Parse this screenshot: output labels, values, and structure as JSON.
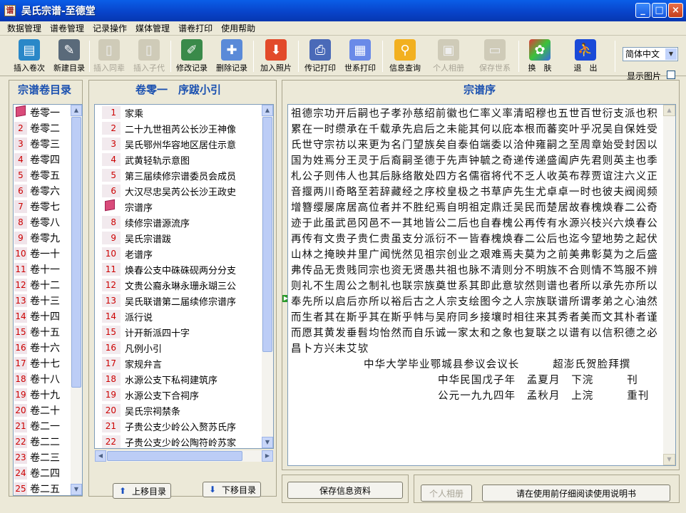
{
  "window": {
    "title": "吴氏宗谱-至德堂",
    "icon_glyph": "谱",
    "minimize": "_",
    "maximize": "□",
    "close": "×"
  },
  "menu": [
    "数据管理",
    "谱卷管理",
    "记录操作",
    "媒体管理",
    "谱卷打印",
    "使用帮助"
  ],
  "toolbar": [
    {
      "label": "插入卷次",
      "icon": "notebook-icon",
      "enabled": true
    },
    {
      "label": "新建目录",
      "icon": "pen-icon",
      "enabled": true
    },
    {
      "label": "插入同辈",
      "icon": "document-icon",
      "enabled": false
    },
    {
      "label": "插入子代",
      "icon": "document-icon",
      "enabled": false
    },
    {
      "label": "修改记录",
      "icon": "edit-icon",
      "enabled": true
    },
    {
      "label": "删除记录",
      "icon": "puzzle-icon",
      "enabled": true
    },
    {
      "label": "加入照片",
      "icon": "download-arrow-icon",
      "enabled": true
    },
    {
      "label": "传记打印",
      "icon": "printer-icon",
      "enabled": true
    },
    {
      "label": "世系打印",
      "icon": "paper-roll-icon",
      "enabled": true
    },
    {
      "label": "信息查询",
      "icon": "magnifier-icon",
      "enabled": true
    },
    {
      "label": "个人相册",
      "icon": "album-icon",
      "enabled": false
    },
    {
      "label": "保存世系",
      "icon": "save-icon",
      "enabled": false
    },
    {
      "label": "换　肤",
      "icon": "palette-icon",
      "enabled": true
    },
    {
      "label": "退　出",
      "icon": "runner-icon",
      "enabled": true
    }
  ],
  "lang_select": {
    "value": "简体中文"
  },
  "show_images_label": "显示图片",
  "left_panel": {
    "title": "宗谱卷目录",
    "items": [
      {
        "num": "",
        "label": "卷零一"
      },
      {
        "num": "2",
        "label": "卷零二"
      },
      {
        "num": "3",
        "label": "卷零三"
      },
      {
        "num": "4",
        "label": "卷零四"
      },
      {
        "num": "5",
        "label": "卷零五"
      },
      {
        "num": "6",
        "label": "卷零六"
      },
      {
        "num": "7",
        "label": "卷零七"
      },
      {
        "num": "8",
        "label": "卷零八"
      },
      {
        "num": "9",
        "label": "卷零九"
      },
      {
        "num": "10",
        "label": "卷一十"
      },
      {
        "num": "11",
        "label": "卷十一"
      },
      {
        "num": "12",
        "label": "卷十二"
      },
      {
        "num": "13",
        "label": "卷十三"
      },
      {
        "num": "14",
        "label": "卷十四"
      },
      {
        "num": "15",
        "label": "卷十五"
      },
      {
        "num": "16",
        "label": "卷十六"
      },
      {
        "num": "17",
        "label": "卷十七"
      },
      {
        "num": "18",
        "label": "卷十八"
      },
      {
        "num": "19",
        "label": "卷十九"
      },
      {
        "num": "20",
        "label": "卷二十"
      },
      {
        "num": "21",
        "label": "卷二一"
      },
      {
        "num": "22",
        "label": "卷二二"
      },
      {
        "num": "23",
        "label": "卷二三"
      },
      {
        "num": "24",
        "label": "卷二四"
      },
      {
        "num": "25",
        "label": "卷二五"
      }
    ]
  },
  "middle_panel": {
    "title": "卷零一　序跋小引",
    "items": [
      {
        "num": "1",
        "label": "家乘"
      },
      {
        "num": "2",
        "label": "二十九世祖芮公长沙王神像"
      },
      {
        "num": "3",
        "label": "吴氏鄂州华容地区居住示意"
      },
      {
        "num": "4",
        "label": "武黄轻轨示意图"
      },
      {
        "num": "5",
        "label": "第三届续修宗谱委员会成员"
      },
      {
        "num": "6",
        "label": "大汉尽忠吴芮公长沙王政史"
      },
      {
        "num": "",
        "label": "宗谱序"
      },
      {
        "num": "8",
        "label": "续修宗谱源流序"
      },
      {
        "num": "9",
        "label": "吴氏宗谱跋"
      },
      {
        "num": "10",
        "label": "老谱序"
      },
      {
        "num": "11",
        "label": "焕春公支中硃硃砚两分分支"
      },
      {
        "num": "12",
        "label": "文贵公裔永琳永珊永瑚三公"
      },
      {
        "num": "13",
        "label": "吴氏联谱第二届续修宗谱序"
      },
      {
        "num": "14",
        "label": "派行说"
      },
      {
        "num": "15",
        "label": "计开新派四十字"
      },
      {
        "num": "16",
        "label": "凡例小引"
      },
      {
        "num": "17",
        "label": "家规弁言"
      },
      {
        "num": "18",
        "label": "水源公支下私祠建筑序"
      },
      {
        "num": "19",
        "label": "水源公支下合祠序"
      },
      {
        "num": "20",
        "label": "吴氏宗祠禁条"
      },
      {
        "num": "21",
        "label": "子贵公支少岭公入赘苏氏序"
      },
      {
        "num": "22",
        "label": "子贵公支少岭公陶符岭苏家"
      }
    ],
    "btn_up": "上移目录",
    "btn_down": "下移目录"
  },
  "right_panel": {
    "title": "宗谱序",
    "body": "祖德宗功开后嗣也子孝孙慈绍前徽也仁率义率清昭穆也五世百世衍支派也积累在一时缵承在千载承先启后之未能其何以庇本根而蕃奕叶乎况吴自保姓受氏世守宗祊以来更为名门望族矣自泰伯端委以洽仲雍嗣之至周章始受封因以国为姓焉分王灵于后裔嗣圣德于先声钟毓之奇递传递盛阖庐先君则英主也季札公子则伟人也其后脉络散处四方名儒宿将代不乏人收英布荐贾谊注六义正音揠两川奇略至若辞藏经之序校皇极之书草庐先生尤卓卓一时也彼夫阀阅频增簪缨屡席居高位者并不胜纪焉自明祖定鼎迁吴民而楚居故春槐焕春二公奇迹于此虽武邑冈邑不一其地皆公二后也自春槐公再传有水源兴枝兴六焕春公再传有文贵子贵仁贵虽支分派衍不一皆春槐焕春二公后也迄今望地势之起伏山林之掩映井里广闻恍然见祖宗创业之艰难焉夫莫为之前美弗彰莫为之后盛弗传品无贵贱同宗也资无贤愚共祖也脉不清则分不明族不合则情不笃服不辨则礼不生周公之制礼也联宗族奠世系其即此意欤然则谱也者所以承先亦所以奉先所以启后亦所以裕后古之人宗支绘图今之人宗族联谱所谓孝弟之心油然而生者其在斯乎其在斯乎帏与吴府同乡接壤时相往来其秀者美而文其朴者谨而愿其黄发垂髫均怡然而自乐诚一家太和之象也复联之以谱有以信积德之必昌卜方兴未艾欤",
    "sig_line1": "中华大学毕业鄂城县参议会议长　　　超澎氏贺脸拜撰",
    "sig_line2": "中华民国戊子年　孟夏月　下浣　　　刊",
    "sig_line3": "公元一九九四年　孟秋月　上浣　　　重刊"
  },
  "bottom_buttons": {
    "save": "保存信息资料",
    "album": "个人相册",
    "manual": "请在使用前仔细阅读使用说明书"
  },
  "colors": {
    "accent": "#1a50b0",
    "title_bar": "#0842c8",
    "number": "#cc0000"
  }
}
